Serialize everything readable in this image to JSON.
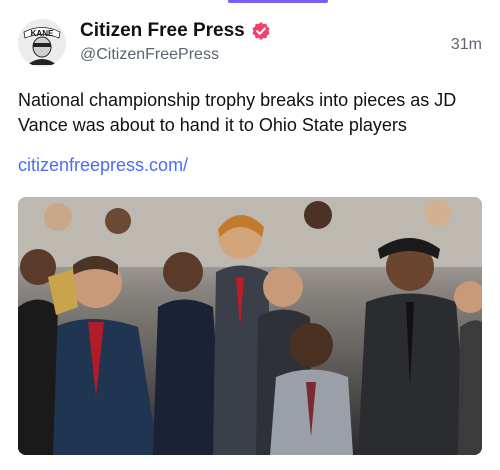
{
  "account": {
    "display_name": "Citizen Free Press",
    "handle": "@CitizenFreePress",
    "avatar_label": "KANE",
    "verified_color": "#f0436b"
  },
  "post": {
    "timestamp": "31m",
    "text": "National championship trophy breaks into pieces as JD Vance was about to hand it to Ohio State players",
    "link": "citizenfreepress.com/"
  },
  "colors": {
    "link": "#4a6cf7",
    "accent": "#7c5cff"
  },
  "media": {
    "type": "photo"
  }
}
